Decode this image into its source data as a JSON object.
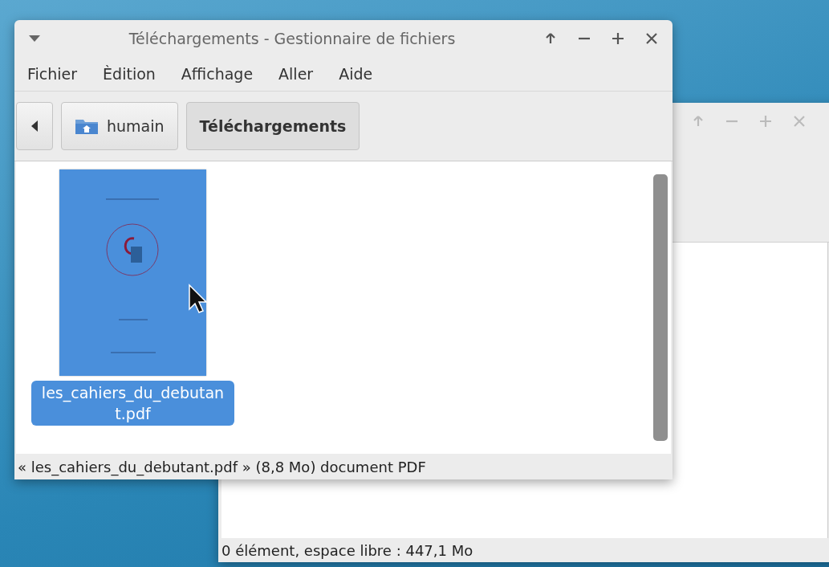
{
  "back_window": {
    "status_bar": "0 élément, espace libre : 447,1 Mo"
  },
  "window": {
    "title": "Téléchargements - Gestionnaire de fichiers",
    "menu": [
      "Fichier",
      "Èdition",
      "Affichage",
      "Aller",
      "Aide"
    ],
    "path_bar": [
      {
        "label": "humain",
        "kind": "home",
        "selected": false
      },
      {
        "label": "Téléchargements",
        "kind": "folder",
        "selected": true
      }
    ],
    "files": [
      {
        "name": "les_cahiers_du_debutant.pdf",
        "selected": true
      }
    ],
    "status_bar": "« les_cahiers_du_debutant.pdf » (8,8 Mo) document PDF"
  }
}
